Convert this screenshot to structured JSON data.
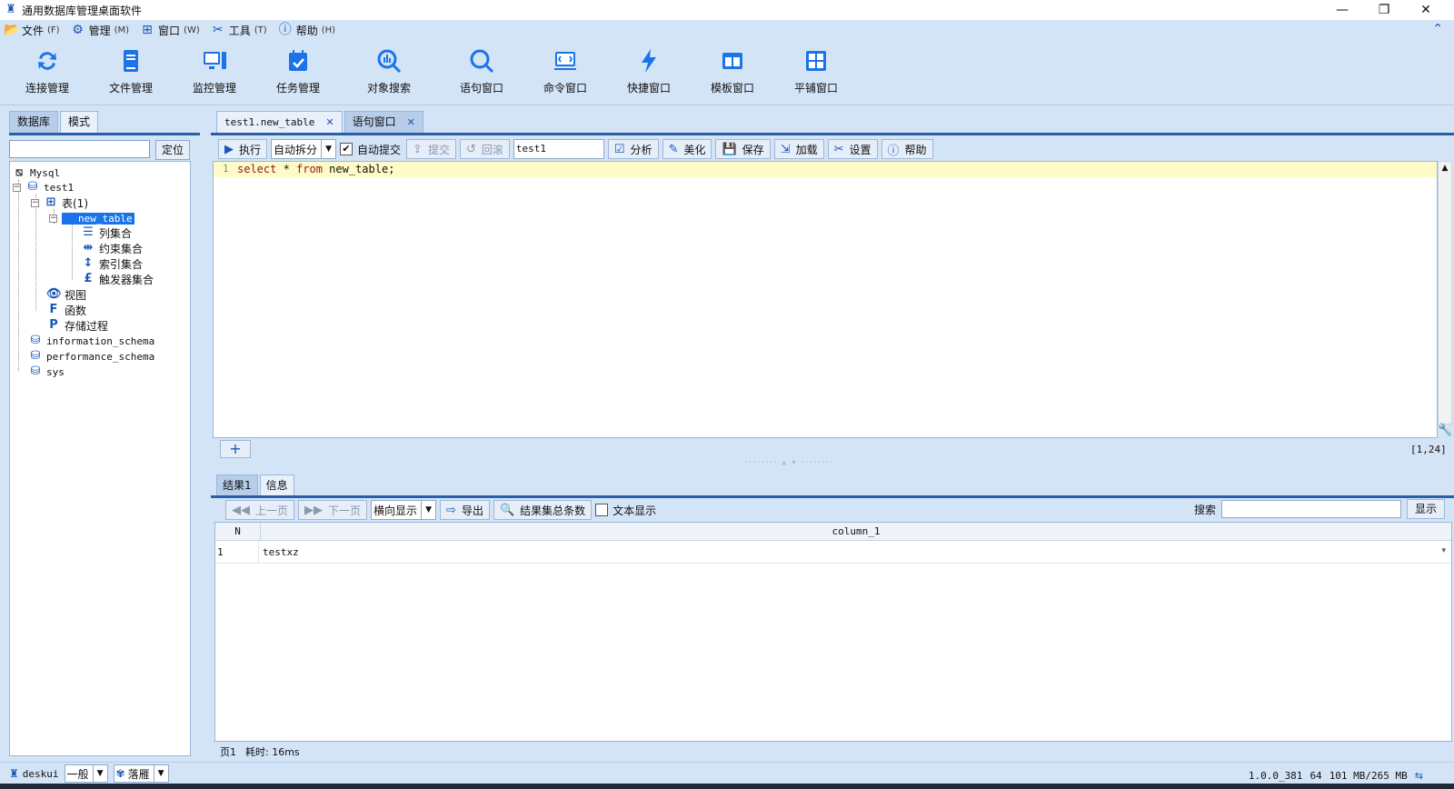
{
  "window": {
    "title": "通用数据库管理桌面软件",
    "minimize_glyph": "—",
    "restore_glyph": "❐",
    "close_glyph": "✕"
  },
  "menu": [
    {
      "label": "文件",
      "accel": "(F)",
      "icon": "folder-icon"
    },
    {
      "label": "管理",
      "accel": "(M)",
      "icon": "gear-icon"
    },
    {
      "label": "窗口",
      "accel": "(W)",
      "icon": "windows-icon"
    },
    {
      "label": "工具",
      "accel": "(T)",
      "icon": "tools-icon"
    },
    {
      "label": "帮助",
      "accel": "(H)",
      "icon": "help-icon"
    }
  ],
  "toolbar": [
    {
      "label": "连接管理",
      "icon": "connection-icon"
    },
    {
      "label": "文件管理",
      "icon": "file-icon"
    },
    {
      "label": "监控管理",
      "icon": "monitor-icon"
    },
    {
      "label": "任务管理",
      "icon": "calendar-icon"
    },
    {
      "label": "对象搜索",
      "icon": "object-search-icon"
    },
    {
      "label": "语句窗口",
      "icon": "search-icon"
    },
    {
      "label": "命令窗口",
      "icon": "terminal-icon"
    },
    {
      "label": "快捷窗口",
      "icon": "lightning-icon"
    },
    {
      "label": "模板窗口",
      "icon": "template-icon"
    },
    {
      "label": "平铺窗口",
      "icon": "grid-icon"
    }
  ],
  "left_panel": {
    "tabs": [
      "数据库",
      "模式"
    ],
    "locate_label": "定位",
    "tree": {
      "root": "Mysql",
      "db1": "test1",
      "tables_node": "表(1)",
      "selected_table": "new_table",
      "columns": "列集合",
      "constraints": "约束集合",
      "indexes": "索引集合",
      "triggers": "触发器集合",
      "views": "视图",
      "functions": "函数",
      "procedures": "存储过程",
      "db2": "information_schema",
      "db3": "performance_schema",
      "db4": "sys"
    }
  },
  "left_status": {
    "user": "deskui",
    "mode": "一般",
    "theme": "落雁"
  },
  "editor": {
    "tabs": [
      {
        "label": "test1.new_table",
        "close": "✕"
      },
      {
        "label": "语句窗口",
        "close": "✕"
      }
    ],
    "toolbar": {
      "execute": "执行",
      "split_mode": "自动拆分",
      "auto_commit": "自动提交",
      "commit": "提交",
      "rollback": "回滚",
      "schema": "test1",
      "analyze": "分析",
      "beautify": "美化",
      "save": "保存",
      "load": "加载",
      "settings": "设置",
      "help": "帮助"
    },
    "line_number": "1",
    "code_kw1": "select",
    "code_mid": " * ",
    "code_kw2": "from",
    "code_rest": " new_table;",
    "add_glyph": "+",
    "cursor_pos": "[1,24]"
  },
  "results": {
    "tabs": [
      "结果1",
      "信息"
    ],
    "toolbar": {
      "prev": "上一页",
      "next": "下一页",
      "orientation": "横向显示",
      "export": "导出",
      "total_count": "结果集总条数",
      "text_display": "文本显示",
      "search_label": "搜索",
      "show": "显示"
    },
    "columns": [
      "N",
      "column_1"
    ],
    "rows": [
      {
        "n": "1",
        "value": "testxz"
      }
    ],
    "page_label": "页1",
    "elapsed": "耗时: 16ms"
  },
  "status": {
    "version": "1.0.0_381",
    "arch": "64",
    "memory": "101 MB/265 MB"
  }
}
